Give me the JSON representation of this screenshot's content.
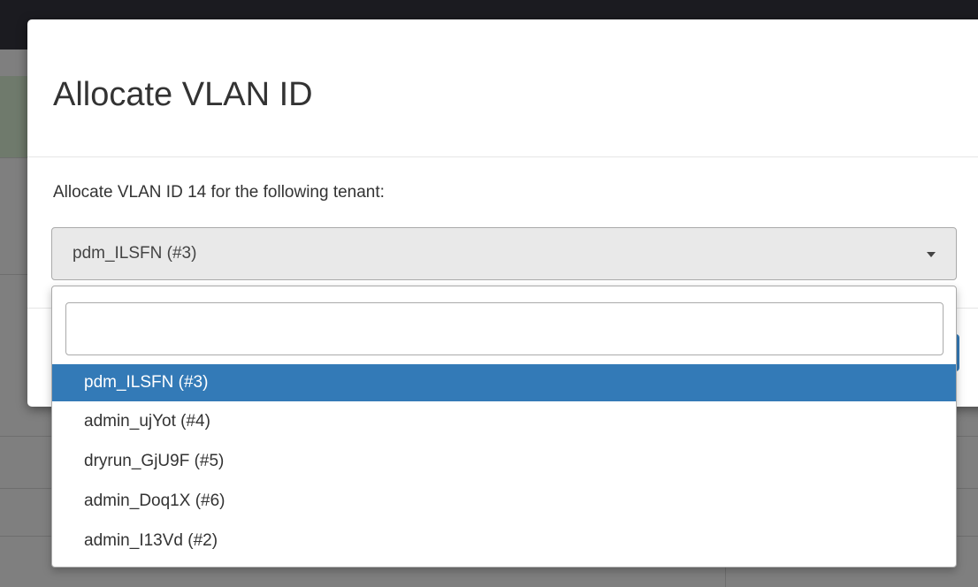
{
  "modal": {
    "title": "Allocate VLAN ID",
    "description": "Allocate VLAN ID 14 for the following tenant:",
    "select": {
      "selected_value": "pdm_ILSFN (#3)"
    }
  },
  "dropdown": {
    "search_value": "",
    "options": [
      {
        "label": "pdm_ILSFN (#3)",
        "selected": true
      },
      {
        "label": "admin_ujYot (#4)",
        "selected": false
      },
      {
        "label": "dryrun_GjU9F (#5)",
        "selected": false
      },
      {
        "label": "admin_Doq1X (#6)",
        "selected": false
      },
      {
        "label": "admin_I13Vd (#2)",
        "selected": false
      }
    ]
  },
  "colors": {
    "highlight": "#337ab7",
    "overlay": "#7f7f7f"
  }
}
